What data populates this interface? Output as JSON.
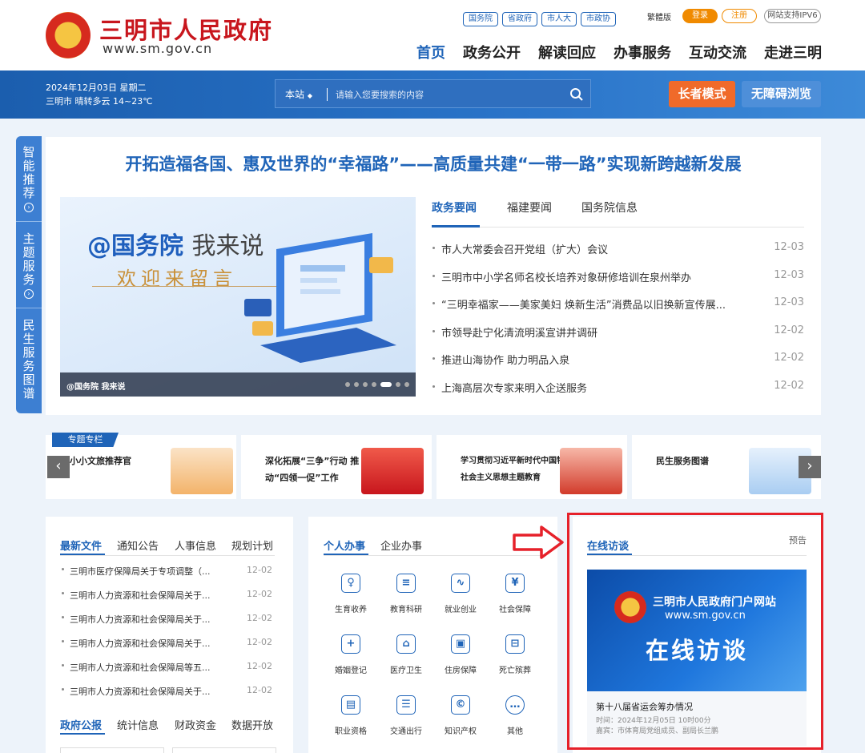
{
  "header": {
    "site_title": "三明市人民政府",
    "site_url": "www.sm.gov.cn",
    "top_links": [
      "国务院",
      "省政府",
      "市人大",
      "市政协"
    ],
    "traditional": "繁體版",
    "login": "登录",
    "register": "注册",
    "ipv6": "网站支持IPV6",
    "nav": [
      "首页",
      "政务公开",
      "解读回应",
      "办事服务",
      "互动交流",
      "走进三明"
    ]
  },
  "band": {
    "date_line": "2024年12月03日 星期二",
    "weather_line": "三明市 晴转多云 14~23℃",
    "search_scope": "本站",
    "search_placeholder": "请输入您要搜索的内容",
    "elder_mode": "长者模式",
    "accessible": "无障碍浏览"
  },
  "sidebar": [
    {
      "label": "智能推荐"
    },
    {
      "label": "主题服务"
    },
    {
      "label": "民生服务图谱"
    }
  ],
  "headline": "开拓造福各国、惠及世界的“幸福路”——高质量共建“一带一路”实现新跨越新发展",
  "banner": {
    "title_a": "@国务院",
    "title_b": "我来说",
    "subtitle": "欢迎来留言",
    "caption": "@国务院 我来说",
    "slide_count": 7,
    "active_slide": 5
  },
  "news": {
    "tabs": [
      "政务要闻",
      "福建要闻",
      "国务院信息"
    ],
    "items": [
      {
        "title": "市人大常委会召开党组（扩大）会议",
        "date": "12-03"
      },
      {
        "title": "三明市中小学名师名校长培养对象研修培训在泉州举办",
        "date": "12-03"
      },
      {
        "title": "“三明幸福家——美家美妇 焕新生活”消费品以旧换新宣传展...",
        "date": "12-03"
      },
      {
        "title": "市领导赴宁化清流明溪宣讲并调研",
        "date": "12-02"
      },
      {
        "title": "推进山海协作 助力明品入泉",
        "date": "12-02"
      },
      {
        "title": "上海高层次专家来明入企送服务",
        "date": "12-02"
      }
    ]
  },
  "strip": {
    "tag": "专题专栏",
    "cards": [
      "小小文旅推荐官",
      "深化拓展“三争”行动 推动“四领一促”工作",
      "学习贯彻习近平新时代中国特色社会主义思想主题教育",
      "民生服务图谱"
    ],
    "prev": "‹",
    "next": "›"
  },
  "docs": {
    "tabs": [
      "最新文件",
      "通知公告",
      "人事信息",
      "规划计划"
    ],
    "items": [
      {
        "title": "三明市医疗保障局关于专项调整（...",
        "date": "12-02"
      },
      {
        "title": "三明市人力资源和社会保障局关于...",
        "date": "12-02"
      },
      {
        "title": "三明市人力资源和社会保障局关于...",
        "date": "12-02"
      },
      {
        "title": "三明市人力资源和社会保障局关于...",
        "date": "12-02"
      },
      {
        "title": "三明市人力资源和社会保障局等五...",
        "date": "12-02"
      },
      {
        "title": "三明市人力资源和社会保障局关于...",
        "date": "12-02"
      }
    ],
    "tabs2": [
      "政府公报",
      "统计信息",
      "财政资金",
      "数据开放"
    ]
  },
  "services": {
    "tabs": [
      "个人办事",
      "企业办事"
    ],
    "items": [
      {
        "label": "生育收养",
        "icon": "baby-icon"
      },
      {
        "label": "教育科研",
        "icon": "book-icon"
      },
      {
        "label": "就业创业",
        "icon": "chart-icon"
      },
      {
        "label": "社会保障",
        "icon": "shield-icon"
      },
      {
        "label": "婚姻登记",
        "icon": "marriage-icon"
      },
      {
        "label": "医疗卫生",
        "icon": "hospital-icon"
      },
      {
        "label": "住房保障",
        "icon": "house-icon"
      },
      {
        "label": "死亡殡葬",
        "icon": "funeral-icon"
      },
      {
        "label": "职业资格",
        "icon": "certificate-icon"
      },
      {
        "label": "交通出行",
        "icon": "car-icon"
      },
      {
        "label": "知识产权",
        "icon": "ip-icon"
      },
      {
        "label": "其他",
        "icon": "more-icon"
      }
    ]
  },
  "interview": {
    "tab": "在线访谈",
    "notice": "预告",
    "poster_line1": "三明市人民政府门户网站",
    "poster_line2": "www.sm.gov.cn",
    "poster_title": "在线访谈",
    "title": "第十八届省运会筹办情况",
    "time": "时间：2024年12月05日 10时00分",
    "guest": "嘉宾：市体育局党组成员、副局长兰鹏"
  },
  "colors": {
    "brand_blue": "#1f64b8",
    "brand_red": "#c8161d",
    "highlight_red": "#e6212a",
    "orange": "#f06a2a"
  }
}
